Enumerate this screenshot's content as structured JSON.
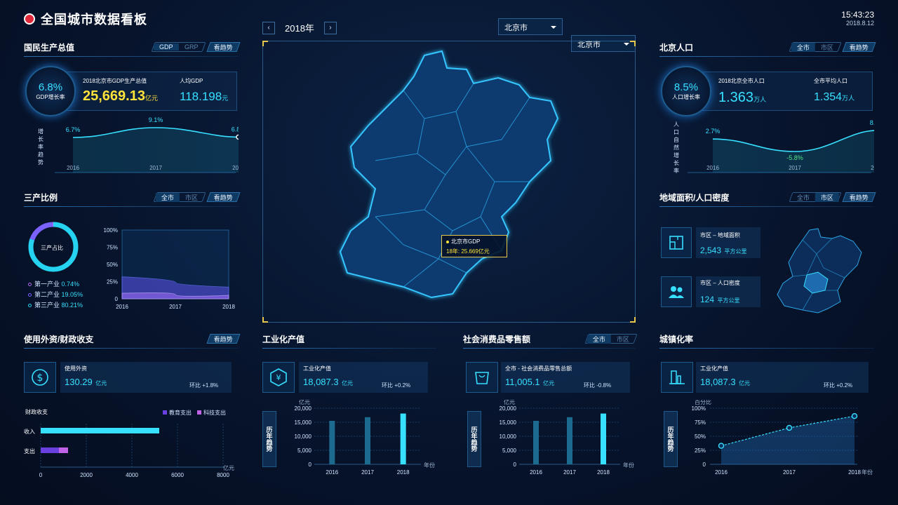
{
  "header": {
    "title": "全国城市数据看板",
    "time": "15:43:23",
    "date": "2018.8.12",
    "year": "2018年",
    "prev": "‹",
    "next": "›",
    "select1": "北京市",
    "select2": "北京市"
  },
  "gdp": {
    "title": "国民生产总值",
    "tabs": [
      "GDP",
      "GRP"
    ],
    "trend": "看趋势",
    "rate": "6.8%",
    "rate_label": "GDP增长率",
    "total_label": "2018北京市GDP生产总值",
    "total": "25,669.13",
    "total_unit": "亿元",
    "per_label": "人均GDP",
    "per": "118.198",
    "per_unit": "元",
    "side_label": "增长率趋势",
    "chart_data": {
      "type": "line",
      "categories": [
        "2016",
        "2017",
        "2018"
      ],
      "values": [
        6.7,
        9.1,
        6.8
      ],
      "labels": [
        "6.7%",
        "9.1%",
        "6.8%"
      ]
    }
  },
  "industry": {
    "title": "三产比例",
    "tabs": [
      "全市",
      "市区"
    ],
    "trend": "看趋势",
    "donut_label": "三产占比",
    "legend": [
      {
        "name": "第一产业",
        "value": "0.74%",
        "color": "#b06cf0"
      },
      {
        "name": "第二产业",
        "value": "19.05%",
        "color": "#7b62ff"
      },
      {
        "name": "第三产业",
        "value": "80.21%",
        "color": "#25d3f0"
      }
    ],
    "chart_data": {
      "type": "area",
      "x": [
        "2016",
        "2017",
        "2018"
      ],
      "ylabels": [
        "100%",
        "75%",
        "50%",
        "25%",
        "0"
      ],
      "series": [
        {
          "name": "第二产业",
          "values": [
            32,
            24,
            17
          ]
        },
        {
          "name": "第一产业",
          "values": [
            8,
            6,
            5
          ]
        }
      ]
    }
  },
  "fdi": {
    "title": "使用外资/财政收支",
    "trend": "看趋势",
    "label": "使用外资",
    "value": "130.29",
    "unit": "亿元",
    "qoq": "环比 +1.8%",
    "fiscal_title": "财政收支",
    "legend": [
      {
        "name": "教育支出",
        "color": "#6a40e0"
      },
      {
        "name": "科技支出",
        "color": "#c163e6"
      }
    ],
    "chart_data": {
      "type": "bar",
      "categories": [
        "收入",
        "支出"
      ],
      "series": [
        {
          "name": "收入",
          "values": [
            5200,
            0
          ]
        },
        {
          "name": "支出",
          "values": [
            5200,
            0
          ]
        },
        {
          "name": "教育支出",
          "values": [
            0,
            800
          ]
        },
        {
          "name": "科技支出",
          "values": [
            0,
            400
          ]
        }
      ],
      "xticks": [
        "0",
        "2000",
        "4000",
        "6000",
        "8000"
      ],
      "xunit": "亿元",
      "xmax": 8000
    }
  },
  "industrial": {
    "title": "工业化产值",
    "label": "工业化产值",
    "value": "18,087.3",
    "unit": "亿元",
    "qoq": "环比 +0.2%",
    "side": "历年趋势",
    "chart_data": {
      "type": "bar",
      "categories": [
        "2016",
        "2017",
        "2018"
      ],
      "values": [
        15500,
        16800,
        18100
      ],
      "yticks": [
        "20,000",
        "15,000",
        "10,000",
        "5,000",
        "0"
      ],
      "yunit": "亿元",
      "xunit": "年份",
      "ymax": 20000
    }
  },
  "retail": {
    "title": "社会消费品零售额",
    "tabs": [
      "全市",
      "市区"
    ],
    "label": "全市 - 社会消费品零售总额",
    "value": "11,005.1",
    "unit": "亿元",
    "qoq": "环比 -0.8%",
    "side": "历年趋势",
    "chart_data": {
      "type": "bar",
      "categories": [
        "2016",
        "2017",
        "2018"
      ],
      "values": [
        15500,
        16800,
        18100
      ],
      "yticks": [
        "20,000",
        "15,000",
        "10,000",
        "5,000",
        "0"
      ],
      "yunit": "亿元",
      "xunit": "年份",
      "ymax": 20000
    }
  },
  "population": {
    "title": "北京人口",
    "tabs": [
      "全市",
      "市区"
    ],
    "trend": "看趋势",
    "rate": "8.5%",
    "rate_label": "人口增长率",
    "total_label": "2018北京全市人口",
    "total": "1.363",
    "total_unit": "万人",
    "avg_label": "全市平均人口",
    "avg": "1.354",
    "avg_unit": "万人",
    "side_label": "人口自然增长率",
    "chart_data": {
      "type": "line",
      "categories": [
        "2016",
        "2017",
        "2018"
      ],
      "values": [
        2.7,
        -5.8,
        8.5
      ],
      "labels": [
        "2.7%",
        "-5.8%",
        "8.5%"
      ]
    }
  },
  "area": {
    "title": "地域面积/人口密度",
    "tabs": [
      "全市",
      "市区"
    ],
    "trend": "看趋势",
    "area_label": "市区 – 地域面积",
    "area_value": "2,543",
    "area_unit": "平方公里",
    "density_label": "市区 – 人口密度",
    "density_value": "124",
    "density_unit": "平方公里"
  },
  "urban": {
    "title": "城镇化率",
    "label": "工业化产值",
    "value": "18,087.3",
    "unit": "亿元",
    "qoq": "环比 +0.2%",
    "side": "历年趋势",
    "chart_data": {
      "type": "line",
      "categories": [
        "2016",
        "2017",
        "2018"
      ],
      "values": [
        33,
        65,
        86
      ],
      "yticks": [
        "100%",
        "75%",
        "50%",
        "25%",
        "0"
      ],
      "yunit": "百分比",
      "xunit": "年份"
    }
  },
  "map": {
    "tooltip_title": "北京市GDP",
    "tooltip_value": "18年: 25.669亿元"
  }
}
